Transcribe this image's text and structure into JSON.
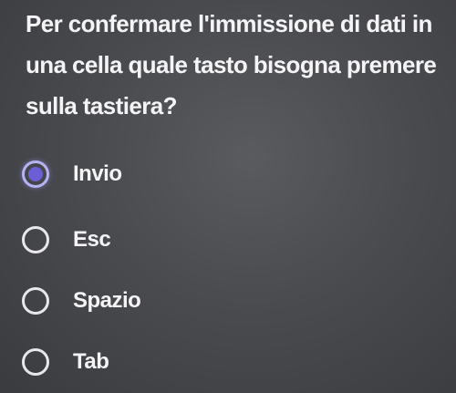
{
  "question": {
    "text": "Per confermare l'immissione di dati in una cella quale tasto bisogna premere sulla tastiera?"
  },
  "options": [
    {
      "label": "Invio",
      "selected": true
    },
    {
      "label": "Esc",
      "selected": false
    },
    {
      "label": "Spazio",
      "selected": false
    },
    {
      "label": "Tab",
      "selected": false
    }
  ],
  "colors": {
    "selected_ring": "#b6b3f5",
    "selected_dot": "#6c5fd6",
    "text": "#f4f4f6",
    "background": "#4a4b4f"
  },
  "icons": {
    "selected": "radio-checked-icon",
    "unselected": "radio-unchecked-icon"
  }
}
